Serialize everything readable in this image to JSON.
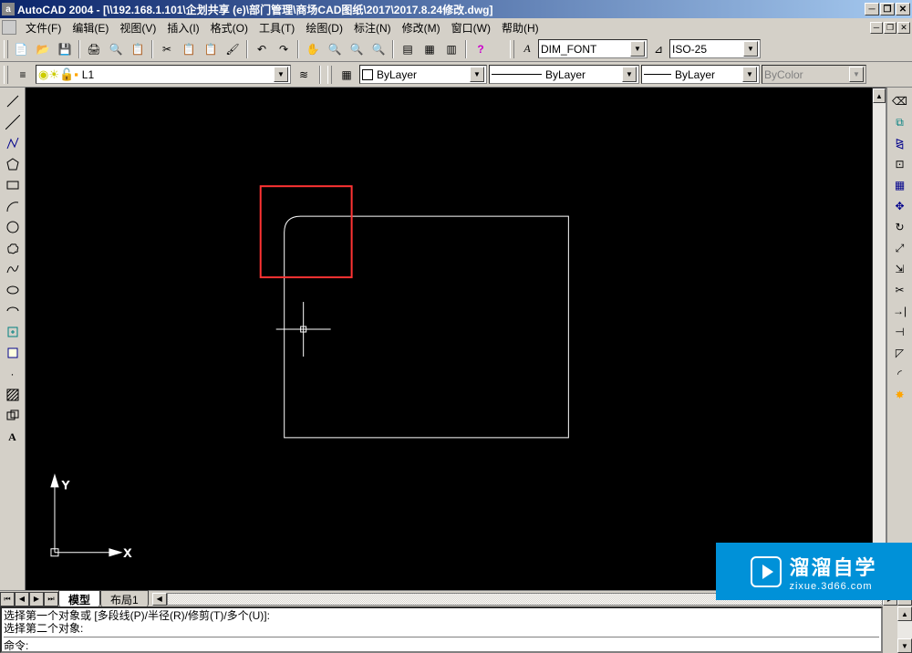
{
  "title": "AutoCAD 2004 - [\\\\192.168.1.101\\企划共享 (e)\\部门管理\\商场CAD图纸\\2017\\2017.8.24修改.dwg]",
  "menu": {
    "file": "文件(F)",
    "edit": "编辑(E)",
    "view": "视图(V)",
    "insert": "插入(I)",
    "format": "格式(O)",
    "tools": "工具(T)",
    "draw": "绘图(D)",
    "dimension": "标注(N)",
    "modify": "修改(M)",
    "window": "窗口(W)",
    "help": "帮助(H)"
  },
  "textstyle": {
    "value": "DIM_FONT"
  },
  "dimstyle": {
    "value": "ISO-25"
  },
  "layer": {
    "value": "L1"
  },
  "props": {
    "color_label": "ByLayer",
    "linetype_label": "ByLayer",
    "lineweight_label": "ByLayer",
    "plotstyle_label": "ByColor"
  },
  "ucs": {
    "x": "X",
    "y": "Y"
  },
  "tabs": {
    "model": "模型",
    "layout1": "布局1"
  },
  "cmd": {
    "line1": "选择第一个对象或 [多段线(P)/半径(R)/修剪(T)/多个(U)]:",
    "line2": "选择第二个对象:",
    "line3": "命令:"
  },
  "watermark": {
    "cn": "溜溜自学",
    "en": "zixue.3d66.com"
  }
}
